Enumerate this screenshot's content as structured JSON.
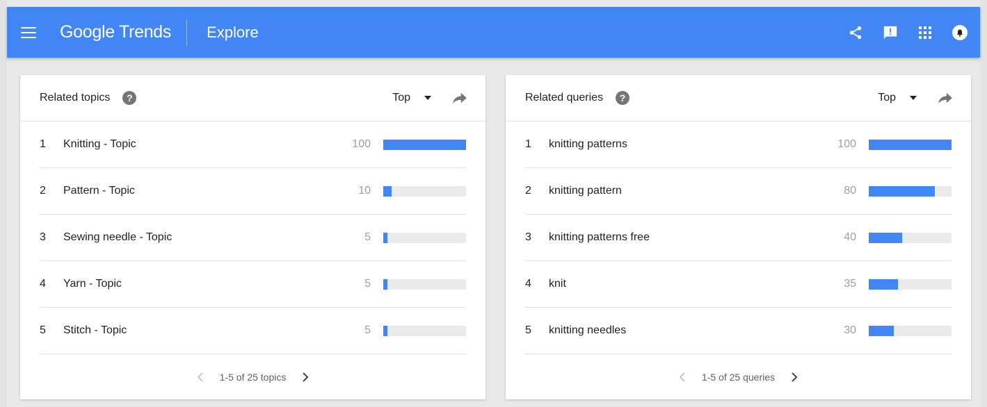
{
  "appbar": {
    "logo_google": "Google",
    "logo_trends": "Trends",
    "page_title": "Explore",
    "color": "#4285f4",
    "icons": [
      "menu-icon",
      "share-icon",
      "feedback-icon",
      "apps-icon",
      "notifications-icon"
    ]
  },
  "related_topics": {
    "title": "Related topics",
    "help": "?",
    "filter": "Top",
    "rows": [
      {
        "rank": "1",
        "label": "Knitting - Topic",
        "value": "100",
        "pct": 100
      },
      {
        "rank": "2",
        "label": "Pattern - Topic",
        "value": "10",
        "pct": 10
      },
      {
        "rank": "3",
        "label": "Sewing needle - Topic",
        "value": "5",
        "pct": 5
      },
      {
        "rank": "4",
        "label": "Yarn - Topic",
        "value": "5",
        "pct": 5
      },
      {
        "rank": "5",
        "label": "Stitch - Topic",
        "value": "5",
        "pct": 5
      }
    ],
    "pager": "1-5 of 25 topics"
  },
  "related_queries": {
    "title": "Related queries",
    "help": "?",
    "filter": "Top",
    "rows": [
      {
        "rank": "1",
        "label": "knitting patterns",
        "value": "100",
        "pct": 100
      },
      {
        "rank": "2",
        "label": "knitting pattern",
        "value": "80",
        "pct": 80
      },
      {
        "rank": "3",
        "label": "knitting patterns free",
        "value": "40",
        "pct": 40
      },
      {
        "rank": "4",
        "label": "knit",
        "value": "35",
        "pct": 35
      },
      {
        "rank": "5",
        "label": "knitting needles",
        "value": "30",
        "pct": 30
      }
    ],
    "pager": "1-5 of 25 queries"
  },
  "colors": {
    "bar": "#4285f4",
    "track": "#ebebeb"
  }
}
